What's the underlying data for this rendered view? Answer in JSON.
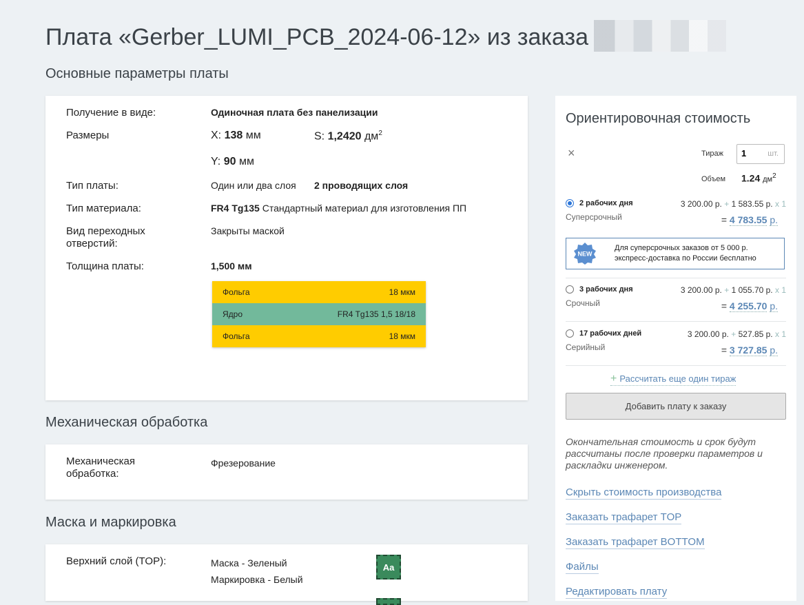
{
  "header": {
    "title": "Плата «Gerber_LUMI_PCB_2024-06-12» из заказа"
  },
  "sections": {
    "main": "Основные параметры платы",
    "mech": "Механическая обработка",
    "mask": "Маска и маркировка"
  },
  "params": {
    "delivery_label": "Получение в виде:",
    "delivery_value": "Одиночная плата без панелизации",
    "size_label": "Размеры",
    "x_label": "X:",
    "x_value": "138",
    "x_unit": "мм",
    "s_label": "S:",
    "s_value": "1,2420",
    "s_unit": "дм",
    "s_sup": "2",
    "y_label": "Y:",
    "y_value": "90",
    "y_unit": "мм",
    "board_type_label": "Тип платы:",
    "board_type_value": "Один или два слоя",
    "board_type_layers": "2 проводящих слоя",
    "material_label": "Тип материала:",
    "material_name": "FR4 Tg135",
    "material_desc": "Стандартный материал для изготовления ПП",
    "via_label": "Вид переходных отверстий:",
    "via_value": "Закрыты маской",
    "thickness_label": "Толщина платы:",
    "thickness_value": "1,500 мм"
  },
  "stackup": [
    {
      "name": "Фольга",
      "value": "18 мкм",
      "color": "#ffcc00"
    },
    {
      "name": "Ядро",
      "value": "FR4 Tg135 1,5 18/18",
      "color": "#72b99b"
    },
    {
      "name": "Фольга",
      "value": "18 мкм",
      "color": "#ffcc00"
    }
  ],
  "mech": {
    "label": "Механическая обработка:",
    "value": "Фрезерование"
  },
  "mask": {
    "top_label": "Верхний слой (TOP):",
    "top_mask": "Маска - Зеленый",
    "top_marking": "Маркировка - Белый",
    "swatch_text": "Aa",
    "swatch_color": "#3a8a5c"
  },
  "cost": {
    "title": "Ориентировочная стоимость",
    "close_icon": "×",
    "qty_label": "Тираж",
    "qty_value": "1",
    "qty_unit": "шт.",
    "volume_label": "Объем",
    "volume_value": "1.24",
    "volume_unit": "дм",
    "volume_sup": "2",
    "options": [
      {
        "days": "2 рабочих дня",
        "type": "Суперсрочный",
        "base": "3 200.00 р.",
        "plus": "+",
        "extra": "1 583.55 р.",
        "times": "x 1",
        "eq": "=",
        "total": "4 783.55",
        "cur": "р."
      },
      {
        "days": "3 рабочих дня",
        "type": "Срочный",
        "base": "3 200.00 р.",
        "plus": "+",
        "extra": "1 055.70 р.",
        "times": "x 1",
        "eq": "=",
        "total": "4 255.70",
        "cur": "р."
      },
      {
        "days": "17 рабочих дней",
        "type": "Серийный",
        "base": "3 200.00 р.",
        "plus": "+",
        "extra": "527.85 р.",
        "times": "x 1",
        "eq": "=",
        "total": "3 727.85",
        "cur": "р."
      }
    ],
    "promo_badge": "NEW",
    "promo_line1": "Для суперсрочных заказов от 5 000 р.",
    "promo_line2": "экспресс-доставка по России бесплатно",
    "calc_more": "Рассчитать еще один тираж",
    "add_button": "Добавить плату к заказу",
    "note": "Окончательная стоимость и срок будут рассчитаны после проверки параметров и раскладки инженером.",
    "links": [
      "Скрыть стоимость производства",
      "Заказать трафарет TOP",
      "Заказать трафарет BOTTOM",
      "Файлы",
      "Редактировать плату"
    ]
  }
}
